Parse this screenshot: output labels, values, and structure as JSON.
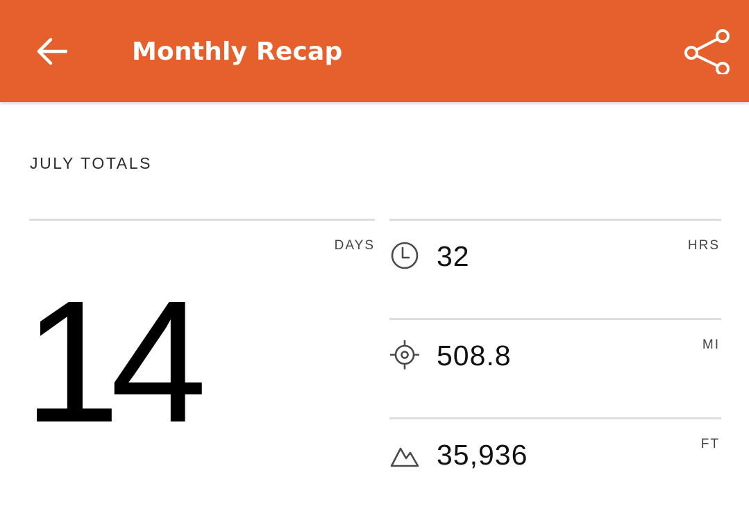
{
  "header": {
    "title": "Monthly Recap",
    "back_icon": "arrow-left-icon",
    "share_icon": "share-icon",
    "background_color": "#E5602D"
  },
  "section": {
    "title": "JULY TOTALS"
  },
  "days": {
    "unit": "DAYS",
    "value": "14"
  },
  "stats": [
    {
      "icon": "clock-icon",
      "value": "32",
      "unit": "HRS"
    },
    {
      "icon": "target-icon",
      "value": "508.8",
      "unit": "MI"
    },
    {
      "icon": "mountain-icon",
      "value": "35,936",
      "unit": "FT"
    }
  ]
}
